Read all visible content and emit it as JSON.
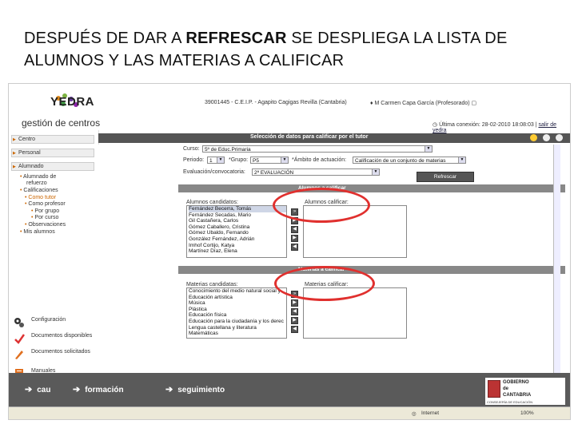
{
  "slide": {
    "title_part1": "DESPUÉS DE DAR A ",
    "title_bold": "REFRESCAR",
    "title_part2": " SE DESPLIEGA LA LISTA DE ALUMNOS Y LAS MATERIAS A CALIFICAR"
  },
  "header": {
    "logo": "YEDRA",
    "subtitle": "gestión de centros",
    "centre": "39001445 - C.E.I.P. - Agapito Cagigas   Revilla (Cantabria)",
    "user": "M Carmen Capa García (Profesorado)",
    "last_connection": "Última conexión:  28-02-2010 18:08:03 |",
    "exit": "salir de yedra"
  },
  "sidebar": {
    "items": [
      {
        "label": "Centro"
      },
      {
        "label": "Personal"
      },
      {
        "label": "Alumnado"
      }
    ],
    "sub_items": [
      {
        "label": "Alumnado de"
      },
      {
        "label": "refuerzo"
      },
      {
        "label": "Calificaciones"
      },
      {
        "label": "Como tutor"
      },
      {
        "label": "Como profesor"
      },
      {
        "label": "Por grupo"
      },
      {
        "label": "Por curso"
      },
      {
        "label": "Observaciones"
      },
      {
        "label": "Mis alumnos"
      }
    ],
    "tools": [
      {
        "label": "Configuración",
        "icon": "gears-icon"
      },
      {
        "label": "Documentos disponibles",
        "icon": "check-doc-icon"
      },
      {
        "label": "Documentos solicitados",
        "icon": "pencil-doc-icon"
      },
      {
        "label": "Manuales",
        "icon": "book-icon"
      }
    ]
  },
  "form": {
    "page_title": "Selección de datos para calificar por el tutor",
    "curso_label": "Curso:",
    "curso_value": "5º de Educ.Primaria",
    "periodo_label": "Periodo:",
    "periodo_value": "1",
    "grupo_label": "*Grupo:",
    "grupo_value": "P5",
    "ambito_label": "*Ámbito de actuación:",
    "ambito_value": "Calificación de un conjunto de materias",
    "evaluacion_label": "Evaluación/convocatoria:",
    "evaluacion_value": "2ª EVALUACIÓN",
    "refresh_button": "Refrescar",
    "section_alumnos": "Alumnos a calificar",
    "alumnos_candidatos_label": "Alumnos candidatos:",
    "alumnos_calificar_label": "Alumnos calificar:",
    "alumnos": [
      "Fernández Becerra, Tomás",
      "Fernández Secadas, Mario",
      "Gil Castañera, Carlos",
      "Gómez Caballero, Cristina",
      "Gómez Ubaldo, Fernando",
      "González Fernández, Adrián",
      "Imhof Cortijo, Katya",
      "Martínez Díaz, Elena"
    ],
    "section_materias": "Materias a calificar",
    "materias_candidatas_label": "Materias candidatas:",
    "materias_calificar_label": "Materias calificar:",
    "materias": [
      "Conocimiento del medio natural social y",
      "Educación artística",
      "Música",
      "Plástica",
      "Educación física",
      "Educación para la ciudadanía y los derec",
      "Lengua castellana y literatura",
      "Matemáticas"
    ]
  },
  "bottom": {
    "links": [
      {
        "label": "cau"
      },
      {
        "label": "formación"
      },
      {
        "label": "seguimiento"
      }
    ],
    "gov_line1": "GOBIERNO",
    "gov_line2": "de",
    "gov_line3": "CANTABRIA",
    "gov_sub": "CONSEJERÍA DE EDUCACIÓN"
  },
  "status": {
    "zone": "Internet",
    "zoom": "100%"
  },
  "colors": {
    "accent": "#e0302e",
    "headbar": "#555555",
    "bottombar": "#5a5a5a"
  }
}
